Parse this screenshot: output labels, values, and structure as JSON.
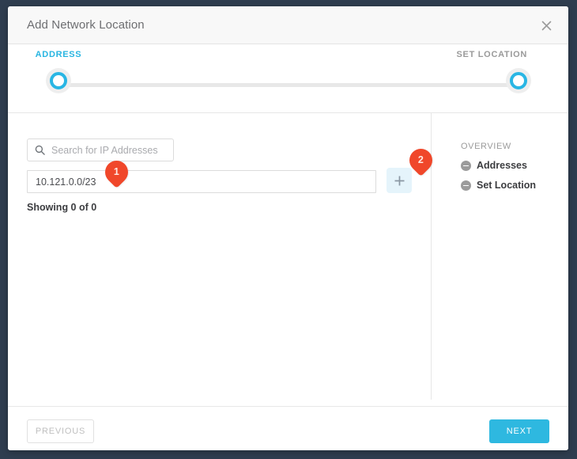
{
  "window": {
    "background_color": "#2f3d4f"
  },
  "header": {
    "title": "Add Network Location",
    "close_icon": "close-icon"
  },
  "stepper": {
    "steps": [
      {
        "label": "ADDRESS",
        "state": "active",
        "color": "#28b5e1"
      },
      {
        "label": "SET LOCATION",
        "state": "upcoming",
        "color": "#9a9a9a"
      }
    ],
    "line_color": "#e8e8e8"
  },
  "main": {
    "search": {
      "placeholder": "Search for IP Addresses",
      "value": "",
      "icon": "search-icon"
    },
    "ip_entry": {
      "value": "10.121.0.0/23",
      "placeholder": "",
      "add_button_icon": "plus-icon"
    },
    "showing_text": "Showing 0 of 0",
    "callouts": [
      {
        "number": "1",
        "color": "#f0472a"
      },
      {
        "number": "2",
        "color": "#f0472a"
      }
    ]
  },
  "overview": {
    "title": "OVERVIEW",
    "items": [
      {
        "label": "Addresses",
        "icon": "circle-minus-icon"
      },
      {
        "label": "Set Location",
        "icon": "circle-minus-icon"
      }
    ]
  },
  "footer": {
    "previous_label": "PREVIOUS",
    "next_label": "NEXT",
    "next_color": "#2eb8e0"
  }
}
